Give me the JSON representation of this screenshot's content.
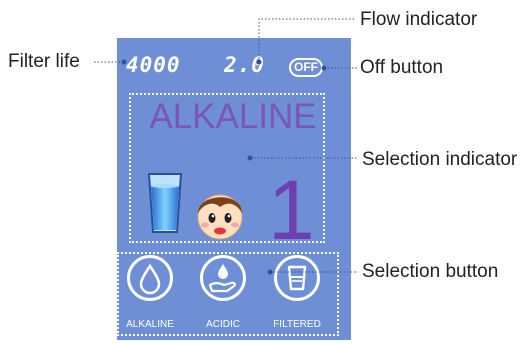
{
  "callouts": {
    "filter_life": "Filter life",
    "flow_indicator": "Flow indicator",
    "off_button": "Off button",
    "selection_indicator": "Selection indicator",
    "selection_button": "Selection button"
  },
  "display": {
    "filter_life_value": "4000",
    "flow_value": "2.0",
    "off_button_label": "OFF",
    "mode_title": "ALKALINE",
    "mode_number": "1"
  },
  "buttons": [
    {
      "label": "ALKALINE",
      "icon": "water-drop-icon"
    },
    {
      "label": "ACIDIC",
      "icon": "hand-drop-icon"
    },
    {
      "label": "FILTERED",
      "icon": "cup-icon"
    }
  ],
  "colors": {
    "panel": "#6e8fd6",
    "mode_text": "#7a56b6",
    "leader_line": "#3050a0"
  }
}
